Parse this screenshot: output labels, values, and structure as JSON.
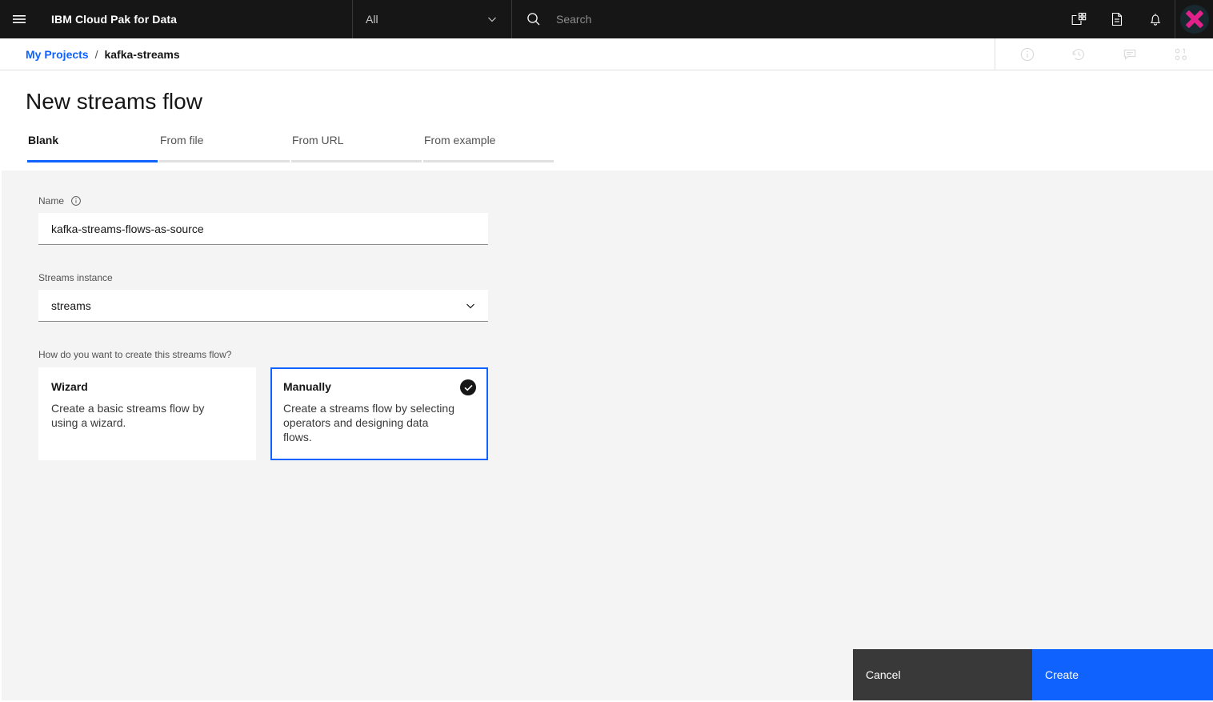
{
  "header": {
    "menu_icon": "hamburger-menu-icon",
    "brand": "IBM Cloud Pak for Data",
    "search_scope": "All",
    "search_placeholder": "Search",
    "search_value": "",
    "icons": [
      "app-switcher-icon",
      "document-icon",
      "notification-bell-icon"
    ],
    "avatar": "user-avatar"
  },
  "breadcrumb": {
    "parent": "My Projects",
    "separator": "/",
    "current": "kafka-streams",
    "tools": [
      "info-icon",
      "history-icon",
      "comment-icon",
      "connections-icon"
    ]
  },
  "page": {
    "title": "New streams flow"
  },
  "tabs": [
    {
      "label": "Blank",
      "active": true
    },
    {
      "label": "From file",
      "active": false
    },
    {
      "label": "From URL",
      "active": false
    },
    {
      "label": "From example",
      "active": false
    }
  ],
  "form": {
    "name": {
      "label": "Name",
      "info_icon": "information-icon",
      "value": "kafka-streams-flows-as-source",
      "placeholder": "Name"
    },
    "instance": {
      "label": "Streams instance",
      "value": "streams",
      "options": [
        "streams"
      ],
      "chevron_icon": "chevron-down-icon"
    },
    "creation_method": {
      "question": "How do you want to create this streams flow?",
      "cards": [
        {
          "title": "Wizard",
          "description": "Create a basic streams flow by using a wizard.",
          "selected": false
        },
        {
          "title": "Manually",
          "description": "Create a streams flow by selecting operators and designing data flows.",
          "selected": true,
          "check_icon": "checkmark-filled-icon"
        }
      ]
    }
  },
  "footer": {
    "cancel_label": "Cancel",
    "create_label": "Create"
  },
  "colors": {
    "header_bg": "#161616",
    "accent_blue": "#0f62fe",
    "content_bg": "#f4f4f4",
    "cancel_bg": "#393939",
    "avatar_pink": "#e0218a"
  }
}
